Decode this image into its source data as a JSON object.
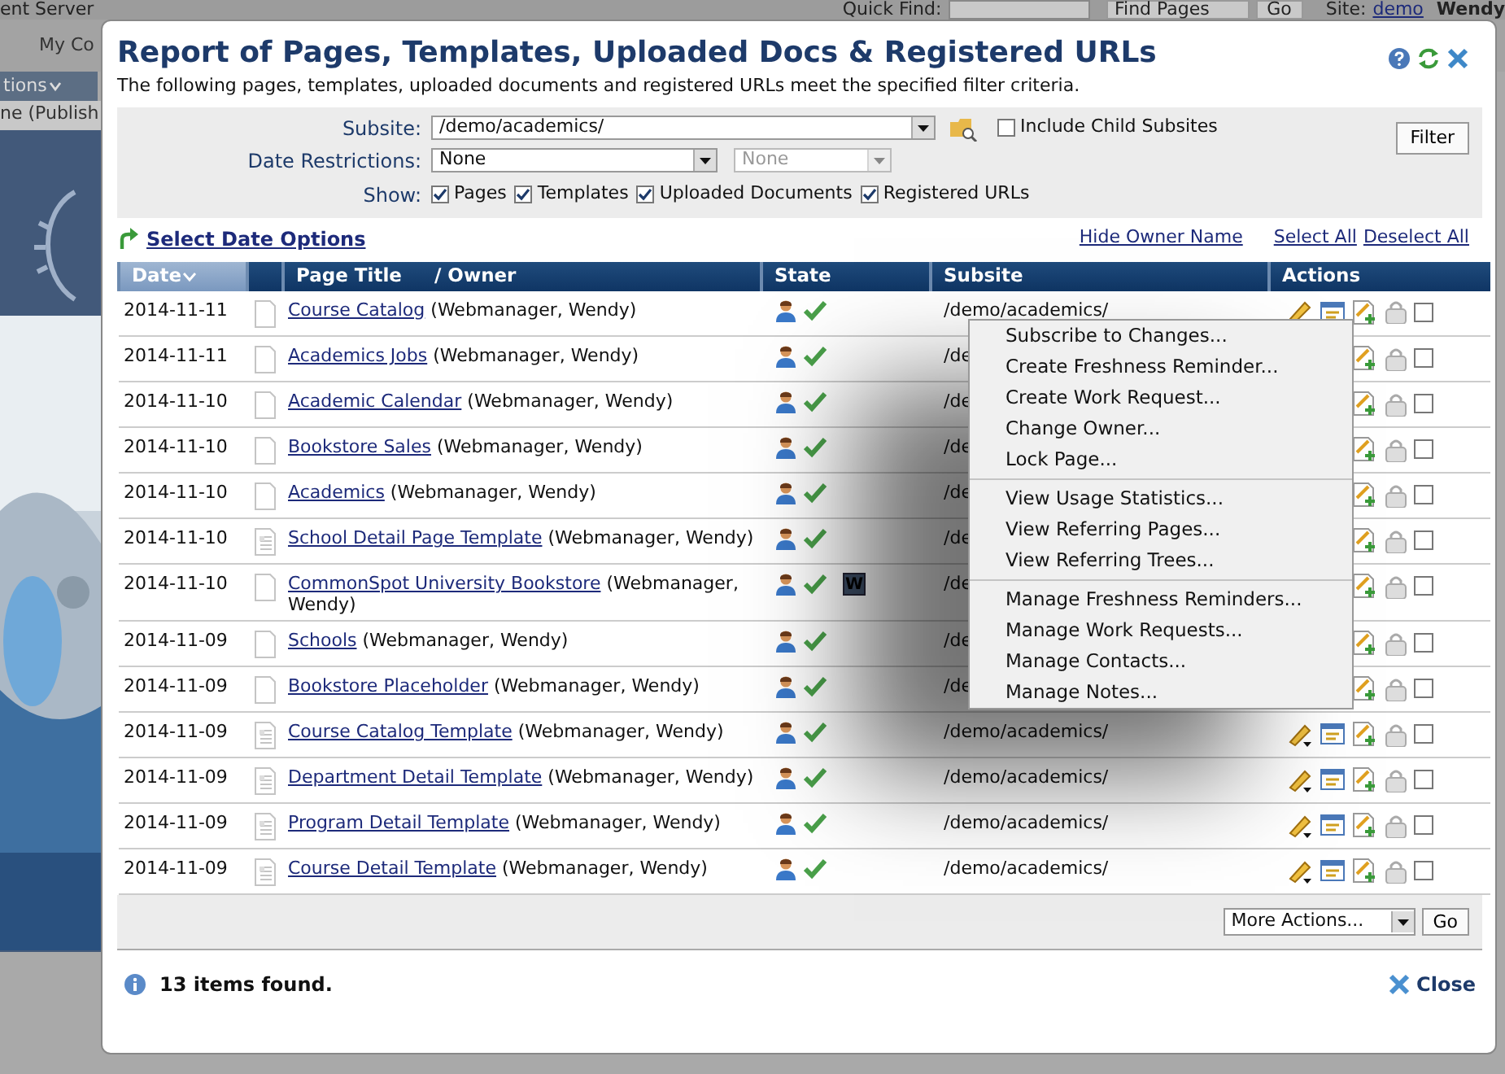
{
  "background": {
    "app_title": "ent Server",
    "quick_find_label": "Quick Find:",
    "find_select": "Find Pages",
    "go": "Go",
    "site_label": "Site:",
    "site_link": "demo",
    "user": "Wendy",
    "tab": "My Co",
    "menu": "tions",
    "status": "ne (Publish"
  },
  "dialog": {
    "title": "Report of Pages, Templates, Uploaded Docs & Registered URLs",
    "subtitle": "The following pages, templates, uploaded documents and registered URLs meet the specified filter criteria.",
    "filter": {
      "subsite_label": "Subsite:",
      "subsite_value": "/demo/academics/",
      "include_child": {
        "label": "Include Child Subsites",
        "checked": false
      },
      "date_label": "Date Restrictions:",
      "date_value": "None",
      "date_value2": "None",
      "show_label": "Show:",
      "show": [
        {
          "label": "Pages",
          "checked": true
        },
        {
          "label": "Templates",
          "checked": true
        },
        {
          "label": "Uploaded Documents",
          "checked": true
        },
        {
          "label": "Registered URLs",
          "checked": true
        }
      ],
      "filter_button": "Filter"
    },
    "links": {
      "select_date_options": "Select Date Options",
      "hide_owner": "Hide Owner Name",
      "select_all": "Select All",
      "deselect_all": "Deselect All"
    },
    "columns": [
      {
        "label": "Date",
        "sorted": true
      },
      {
        "label": "Page Title     / Owner",
        "sorted": false
      },
      {
        "label": "State",
        "sorted": false
      },
      {
        "label": "Subsite",
        "sorted": false
      },
      {
        "label": "Actions",
        "sorted": false
      }
    ],
    "rows": [
      {
        "date": "2014-11-11",
        "kind": "page",
        "title": "Course Catalog",
        "owner": "(Webmanager, Wendy)",
        "subsite": "/demo/academics/",
        "checked": false
      },
      {
        "date": "2014-11-11",
        "kind": "page",
        "title": "Academics Jobs",
        "owner": "(Webmanager, Wendy)",
        "subsite": "/de",
        "checked": false
      },
      {
        "date": "2014-11-10",
        "kind": "page",
        "title": "Academic Calendar",
        "owner": "(Webmanager, Wendy)",
        "subsite": "/de",
        "checked": false
      },
      {
        "date": "2014-11-10",
        "kind": "page",
        "title": "Bookstore Sales",
        "owner": "(Webmanager, Wendy)",
        "subsite": "/de",
        "checked": false
      },
      {
        "date": "2014-11-10",
        "kind": "page",
        "title": "Academics",
        "owner": "(Webmanager, Wendy)",
        "subsite": "/de",
        "checked": false
      },
      {
        "date": "2014-11-10",
        "kind": "template",
        "title": "School Detail Page Template",
        "owner": "(Webmanager, Wendy)",
        "subsite": "/de",
        "checked": false
      },
      {
        "date": "2014-11-10",
        "kind": "page",
        "title": "CommonSpot University Bookstore",
        "owner": "(Webmanager, Wendy)",
        "workflow": "W",
        "subsite": "/de",
        "checked": false
      },
      {
        "date": "2014-11-09",
        "kind": "page",
        "title": "Schools",
        "owner": "(Webmanager, Wendy)",
        "subsite": "/de",
        "checked": false
      },
      {
        "date": "2014-11-09",
        "kind": "page",
        "title": "Bookstore Placeholder",
        "owner": "(Webmanager, Wendy)",
        "subsite": "/de",
        "checked": false
      },
      {
        "date": "2014-11-09",
        "kind": "template",
        "title": "Course Catalog Template",
        "owner": "(Webmanager, Wendy)",
        "subsite": "/demo/academics/",
        "checked": false
      },
      {
        "date": "2014-11-09",
        "kind": "template",
        "title": "Department Detail Template",
        "owner": "(Webmanager, Wendy)",
        "subsite": "/demo/academics/",
        "checked": false
      },
      {
        "date": "2014-11-09",
        "kind": "template",
        "title": "Program Detail Template",
        "owner": "(Webmanager, Wendy)",
        "subsite": "/demo/academics/",
        "checked": false
      },
      {
        "date": "2014-11-09",
        "kind": "template",
        "title": "Course Detail Template",
        "owner": "(Webmanager, Wendy)",
        "subsite": "/demo/academics/",
        "checked": false
      }
    ],
    "more_actions": "More Actions...",
    "go": "Go",
    "count": "13 items found.",
    "close": "Close"
  },
  "context_menu": {
    "groups": [
      [
        "Subscribe to Changes...",
        "Create Freshness Reminder...",
        "Create Work Request...",
        "Change Owner...",
        "Lock Page..."
      ],
      [
        "View Usage Statistics...",
        "View Referring Pages...",
        "View Referring Trees..."
      ],
      [
        "Manage Freshness Reminders...",
        "Manage Work Requests...",
        "Manage Contacts...",
        "Manage Notes..."
      ]
    ]
  }
}
